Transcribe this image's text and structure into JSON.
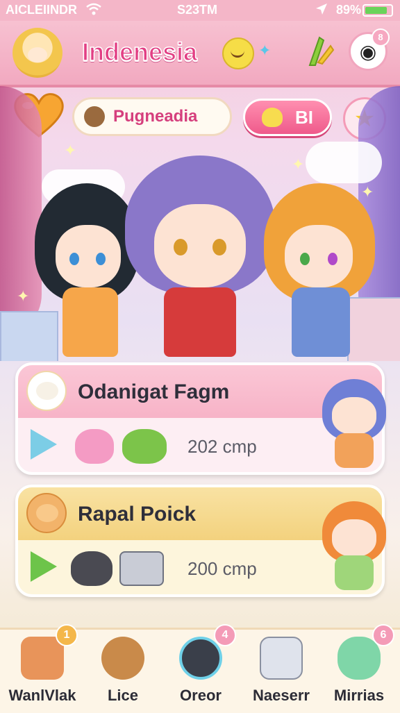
{
  "status_bar": {
    "carrier": "AICLEIINDR",
    "time": "S23TM",
    "battery": "89%",
    "battery_level": 0.85
  },
  "header": {
    "title": "Indenesia",
    "settings_badge": "8"
  },
  "top_controls": {
    "category_label": "Pugneadia",
    "action_label": "BI"
  },
  "cards": [
    {
      "title": "Odanigat Fagm",
      "count": "202 cmp"
    },
    {
      "title": "Rapal Poick",
      "count": "200 cmp"
    }
  ],
  "nav": [
    {
      "label": "WanlVlak",
      "badge": "1",
      "badge_color": "#f4b74a"
    },
    {
      "label": "Lice",
      "badge": "",
      "badge_color": "#f4b74a"
    },
    {
      "label": "Oreor",
      "badge": "4",
      "badge_color": "#f49bb7"
    },
    {
      "label": "Naeserr",
      "badge": "",
      "badge_color": "#f49bb7"
    },
    {
      "label": "Mirrias",
      "badge": "6",
      "badge_color": "#f49bb7"
    }
  ],
  "colors": {
    "accent_pink": "#e23f84",
    "header_pink": "#f4b6c8",
    "play_blue": "#7ccde6",
    "play_green": "#6dc44a"
  },
  "icons": [
    "heart-icon",
    "star-icon",
    "settings-icon",
    "play-icon",
    "wifi-icon",
    "location-icon",
    "battery-icon"
  ]
}
